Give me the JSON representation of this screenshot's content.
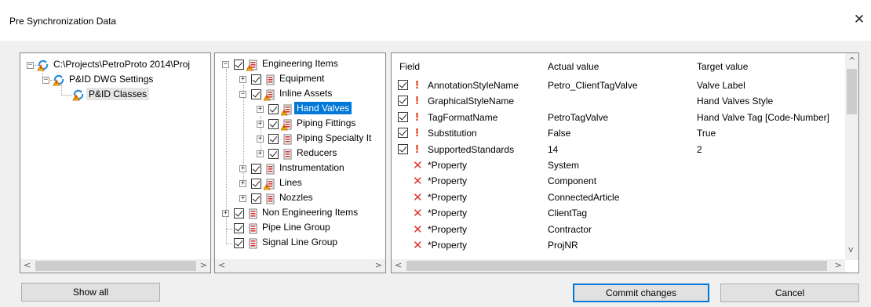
{
  "window": {
    "title": "Pre Synchronization Data",
    "close_glyph": "✕"
  },
  "left_tree": {
    "nodes": [
      {
        "label": "C:\\Projects\\PetroProto 2014\\Proj"
      },
      {
        "label": "P&ID DWG Settings"
      },
      {
        "label": "P&ID Classes",
        "selected": true
      }
    ]
  },
  "middle_tree": {
    "nodes": [
      {
        "label": "Engineering Items",
        "icon": "warning-list-icon",
        "checked": true
      },
      {
        "label": "Equipment",
        "icon": "list-icon",
        "checked": true
      },
      {
        "label": "Inline Assets",
        "icon": "warning-list-icon",
        "checked": true
      },
      {
        "label": "Hand Valves",
        "icon": "warning-list-icon",
        "checked": true,
        "selected": true
      },
      {
        "label": "Piping Fittings",
        "icon": "warning-list-icon",
        "checked": true
      },
      {
        "label": "Piping Specialty It",
        "icon": "list-icon",
        "checked": true
      },
      {
        "label": "Reducers",
        "icon": "list-icon",
        "checked": true
      },
      {
        "label": "Instrumentation",
        "icon": "list-icon",
        "checked": true
      },
      {
        "label": "Lines",
        "icon": "warning-list-icon",
        "checked": true
      },
      {
        "label": "Nozzles",
        "icon": "list-icon",
        "checked": true
      },
      {
        "label": "Non Engineering Items",
        "icon": "list-icon",
        "checked": true
      },
      {
        "label": "Pipe Line Group",
        "icon": "list-icon",
        "checked": true
      },
      {
        "label": "Signal Line Group",
        "icon": "list-icon",
        "checked": true
      }
    ]
  },
  "grid": {
    "columns": [
      "Field",
      "Actual value",
      "Target value"
    ],
    "rows": [
      {
        "kind": "checked",
        "field": "AnnotationStyleName",
        "actual": "Petro_ClientTagValve",
        "target": "Valve Label"
      },
      {
        "kind": "checked",
        "field": "GraphicalStyleName",
        "actual": "",
        "target": "Hand Valves Style"
      },
      {
        "kind": "checked",
        "field": "TagFormatName",
        "actual": "PetroTagValve",
        "target": "Hand Valve Tag [Code-Number]"
      },
      {
        "kind": "checked",
        "field": "Substitution",
        "actual": "False",
        "target": "True"
      },
      {
        "kind": "checked",
        "field": "SupportedStandards",
        "actual": "14",
        "target": "2"
      },
      {
        "kind": "removed",
        "field": "*Property",
        "actual": "System",
        "target": ""
      },
      {
        "kind": "removed",
        "field": "*Property",
        "actual": "Component",
        "target": ""
      },
      {
        "kind": "removed",
        "field": "*Property",
        "actual": "ConnectedArticle",
        "target": ""
      },
      {
        "kind": "removed",
        "field": "*Property",
        "actual": "ClientTag",
        "target": ""
      },
      {
        "kind": "removed",
        "field": "*Property",
        "actual": "Contractor",
        "target": ""
      },
      {
        "kind": "removed",
        "field": "*Property",
        "actual": "ProjNR",
        "target": ""
      }
    ]
  },
  "buttons": {
    "show_all": "Show all",
    "commit": "Commit changes",
    "cancel": "Cancel"
  },
  "glyphs": {
    "exclaim": "!",
    "xmark": "✕",
    "left": "<",
    "right": ">",
    "up": "^",
    "down": "v",
    "plus": "+",
    "minus": "−"
  },
  "colors": {
    "selection": "#0078d7",
    "warning": "#e03000",
    "removed": "#e03030"
  }
}
